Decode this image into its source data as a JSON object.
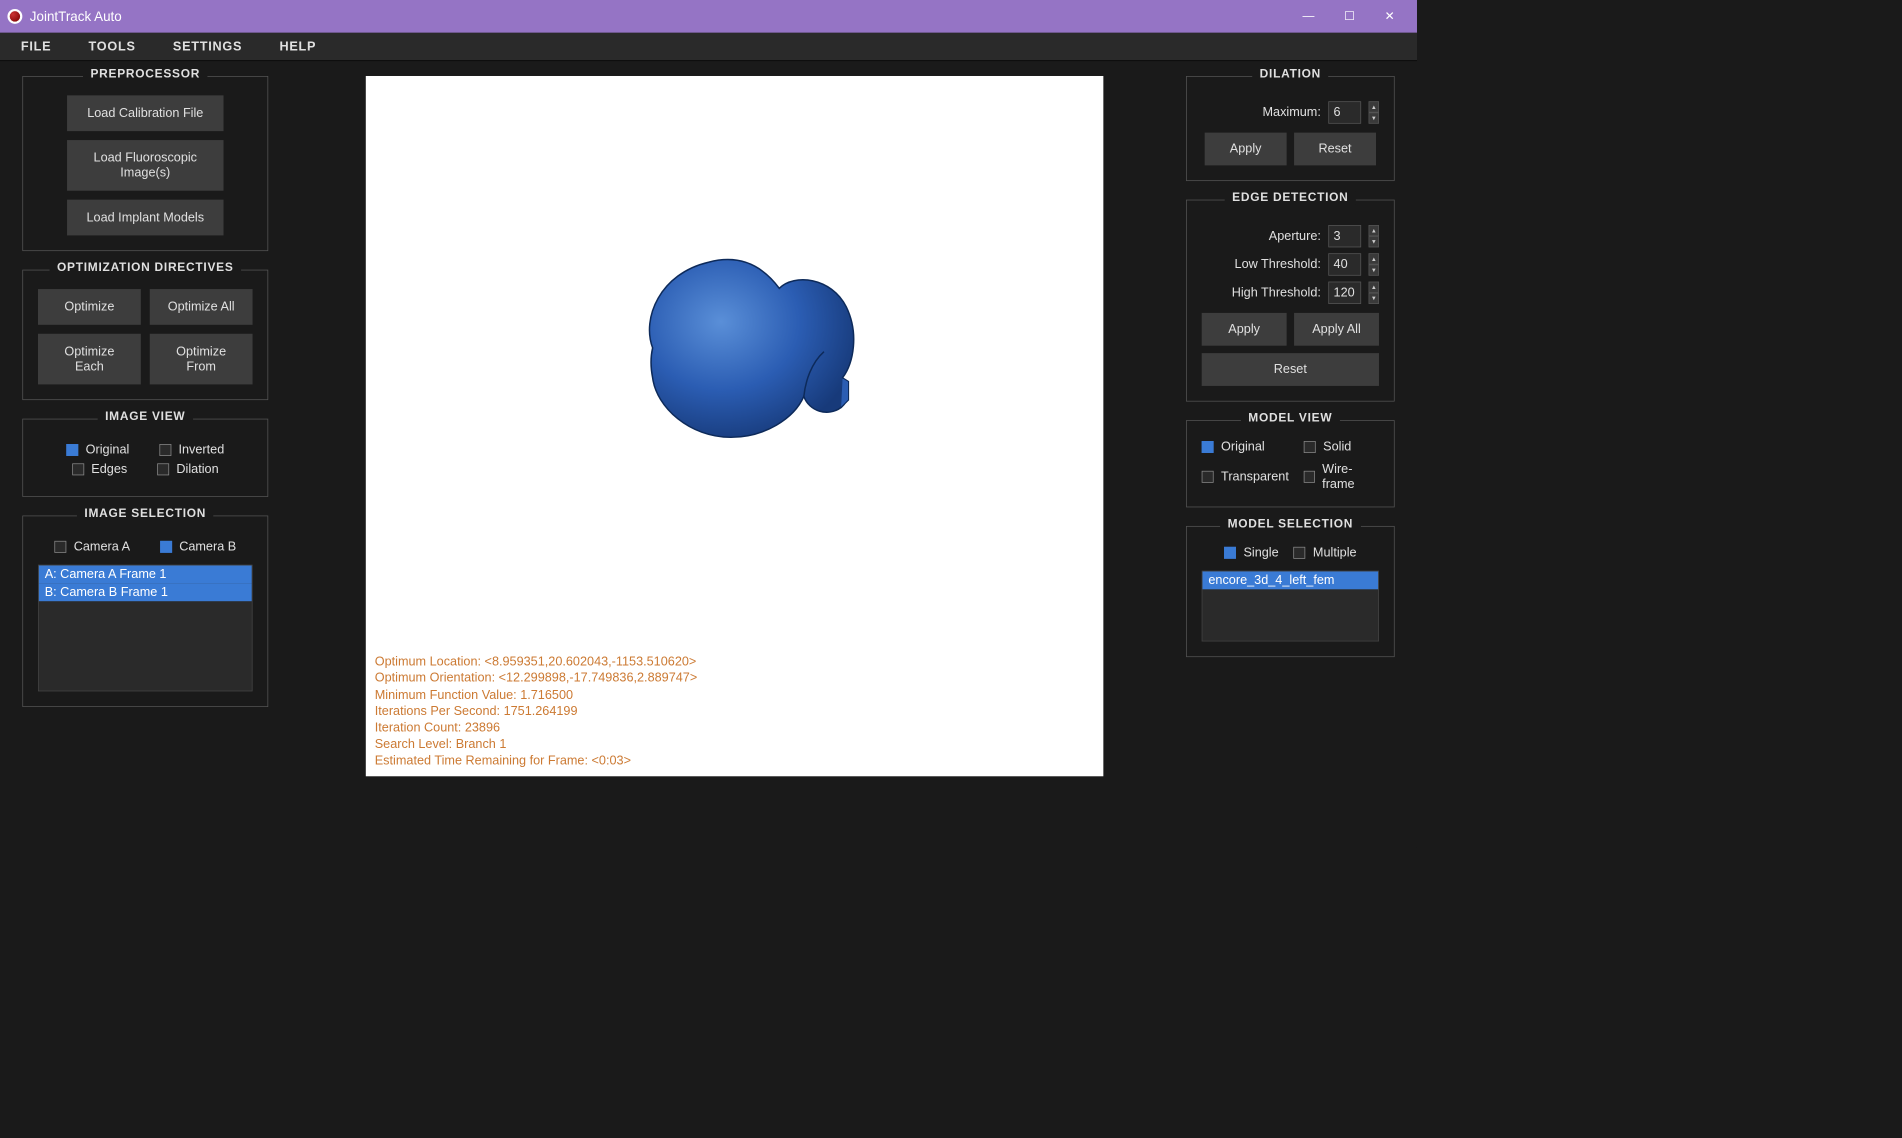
{
  "window": {
    "title": "JointTrack Auto"
  },
  "menu": {
    "file": "FILE",
    "tools": "TOOLS",
    "settings": "SETTINGS",
    "help": "HELP"
  },
  "preprocessor": {
    "title": "PREPROCESSOR",
    "load_calib": "Load Calibration File",
    "load_fluoro": "Load Fluoroscopic Image(s)",
    "load_implant": "Load Implant Models"
  },
  "optimization": {
    "title": "OPTIMIZATION DIRECTIVES",
    "optimize": "Optimize",
    "optimize_all": "Optimize All",
    "optimize_each": "Optimize Each",
    "optimize_from": "Optimize From"
  },
  "image_view": {
    "title": "IMAGE VIEW",
    "original": "Original",
    "inverted": "Inverted",
    "edges": "Edges",
    "dilation": "Dilation"
  },
  "image_selection": {
    "title": "IMAGE SELECTION",
    "camera_a": "Camera A",
    "camera_b": "Camera B",
    "items": [
      "A: Camera A Frame 1",
      "B: Camera B Frame 1"
    ]
  },
  "dilation": {
    "title": "DILATION",
    "maximum_label": "Maximum:",
    "maximum": "6",
    "apply": "Apply",
    "reset": "Reset"
  },
  "edge_detection": {
    "title": "EDGE DETECTION",
    "aperture_label": "Aperture:",
    "aperture": "3",
    "low_label": "Low Threshold:",
    "low": "40",
    "high_label": "High Threshold:",
    "high": "120",
    "apply": "Apply",
    "apply_all": "Apply All",
    "reset": "Reset"
  },
  "model_view": {
    "title": "MODEL VIEW",
    "original": "Original",
    "solid": "Solid",
    "transparent": "Transparent",
    "wireframe": "Wire-frame"
  },
  "model_selection": {
    "title": "MODEL SELECTION",
    "single": "Single",
    "multiple": "Multiple",
    "items": [
      "encore_3d_4_left_fem"
    ]
  },
  "status": {
    "lines": [
      "Optimum Location: <8.959351,20.602043,-1153.510620>",
      "Optimum Orientation: <12.299898,-17.749836,2.889747>",
      "Minimum Function Value: 1.716500",
      "Iterations Per Second: 1751.264199",
      "Iteration Count: 23896",
      "Search Level: Branch 1",
      "Estimated Time Remaining for Frame: <0:03>"
    ]
  }
}
